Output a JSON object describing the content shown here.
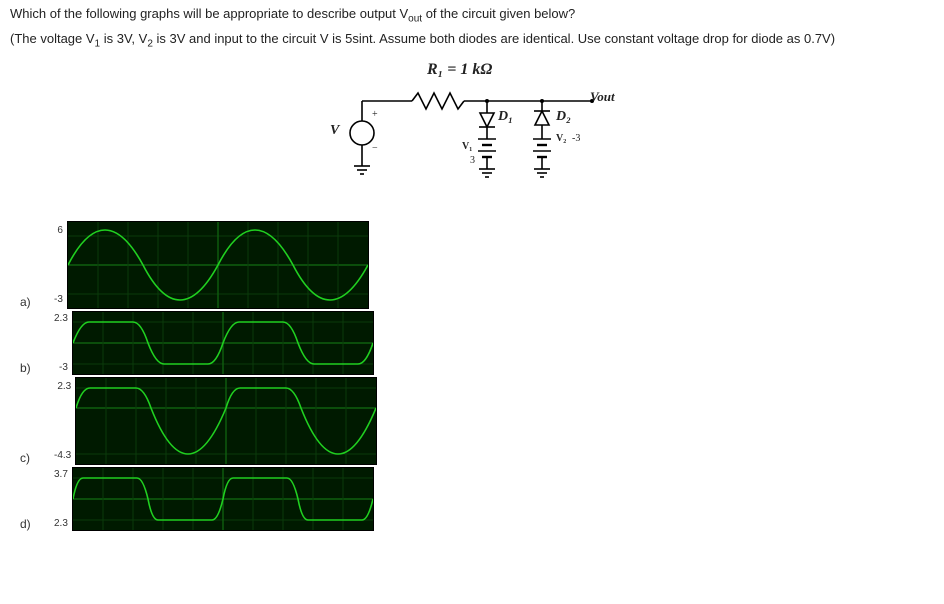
{
  "question": {
    "line1": "Which of the following graphs will be appropriate to describe output V<sub>out</sub> of the circuit given below?",
    "line2": "(The voltage V<sub>1</sub> is 3V, V<sub>2</sub> is 3V and input to the circuit V is 5sint. Assume both diodes are identical. Use constant voltage drop for diode as 0.7V)"
  },
  "circuit": {
    "r1": "R₁ = 1 kΩ",
    "v": "V",
    "d1": "D₁",
    "d2": "D₂",
    "v1": "V₁",
    "v1val": "3",
    "v2": "V₂",
    "v2val": "-3",
    "vout": "Vout",
    "plus": "+",
    "minus": "−"
  },
  "options": {
    "a": {
      "label": "a)",
      "yTop": "6",
      "yBot": "-3"
    },
    "b": {
      "label": "b)",
      "yTop": "2.3",
      "yBot": "-3"
    },
    "c": {
      "label": "c)",
      "yTop": "2.3",
      "yBot": "-4.3"
    },
    "d": {
      "label": "d)",
      "yTop": "3.7",
      "yBot": "2.3"
    }
  },
  "chart_data": [
    {
      "option": "a",
      "type": "line",
      "title": "Option a waveform",
      "ylim": [
        -6,
        6
      ],
      "xrange": "2 periods",
      "shape": "full sine 5sin(t), no clipping",
      "series": [
        {
          "name": "Vout",
          "desc": "5 sin(t)"
        }
      ]
    },
    {
      "option": "b",
      "type": "line",
      "title": "Option b waveform",
      "ylim": [
        -3,
        2.3
      ],
      "xrange": "2 periods",
      "shape": "sine clipped flat at top=2.3 and bottom=-3; rises with sine, holds at 2.3, falls with sine, holds at -3",
      "series": [
        {
          "name": "Vout",
          "desc": "clip(5 sin t, -3, 2.3)"
        }
      ]
    },
    {
      "option": "c",
      "type": "line",
      "title": "Option c waveform",
      "ylim": [
        -4.3,
        2.3
      ],
      "xrange": "2 periods",
      "shape": "sine clipped flat at top=2.3, deep negative lobes down to -4.3",
      "series": [
        {
          "name": "Vout",
          "desc": "clip_top(5 sin t, 2.3) then lower trough -4.3"
        }
      ]
    },
    {
      "option": "d",
      "type": "line",
      "title": "Option d waveform",
      "ylim": [
        2.3,
        3.7
      ],
      "xrange": "2 periods",
      "shape": "square-ish wave alternating between 3.7 and 2.3 with small rounded transitions",
      "series": [
        {
          "name": "Vout",
          "desc": "clipped to [2.3, 3.7]"
        }
      ]
    }
  ]
}
